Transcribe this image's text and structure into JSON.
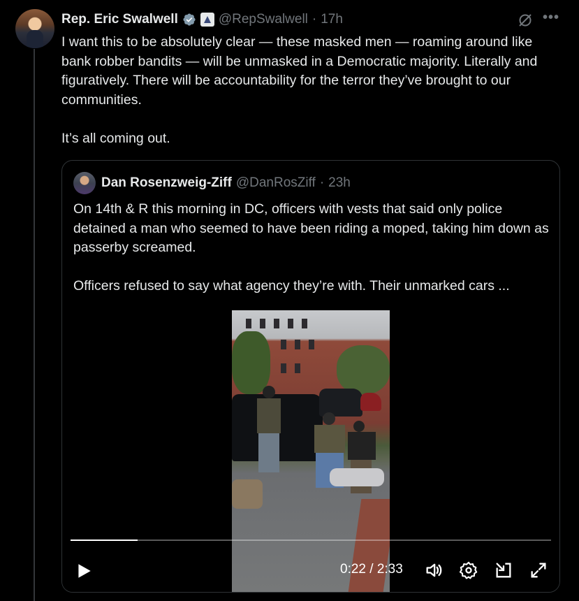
{
  "tweet": {
    "author_name": "Rep. Eric Swalwell",
    "handle": "@RepSwalwell",
    "separator": "·",
    "time": "17h",
    "text_paragraphs": [
      "I want this to be absolutely clear — these masked men — roaming around like bank robber bandits — will be unmasked in a Democratic majority. Literally and figuratively.  There will be accountability for the terror they’ve brought to our communities.",
      "It’s all coming out."
    ],
    "more_icon": "•••"
  },
  "quote": {
    "author_name": "Dan Rosenzweig-Ziff",
    "handle": "@DanRosZiff",
    "separator": "·",
    "time": "23h",
    "text_paragraphs": [
      "On 14th & R this morning in DC, officers with vests that said only police detained a man who seemed to have been riding a moped, taking him down as passerby screamed.",
      "Officers refused to say what agency they’re with. Their unmarked cars ..."
    ]
  },
  "video": {
    "current_time": "0:22",
    "duration": "2:33",
    "time_display": "0:22 / 2:33",
    "progress_fraction": 0.14
  },
  "icons": {
    "verified": "verified-badge-icon",
    "gov": "government-badge-icon",
    "grok": "grok-icon",
    "more": "more-icon",
    "play": "play-icon",
    "volume": "volume-icon",
    "settings": "settings-icon",
    "pip": "picture-in-picture-icon",
    "fullscreen": "fullscreen-icon"
  },
  "colors": {
    "background": "#000000",
    "text": "#e7e9ea",
    "muted": "#71767b",
    "verified_blue": "#1d9bf0",
    "border": "#2f3336"
  }
}
